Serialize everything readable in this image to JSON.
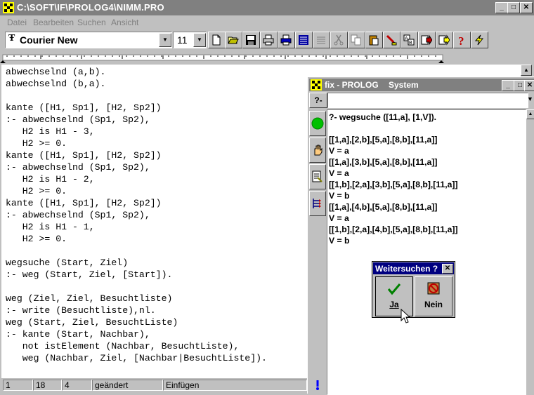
{
  "window": {
    "title": "C:\\SOFT\\IF\\PROLOG4\\NIMM.PRO",
    "minimize": "_",
    "maximize": "□",
    "close": "✕"
  },
  "menu": [
    "Datei",
    "Bearbeiten",
    "Suchen",
    "Ansicht"
  ],
  "toolbar": {
    "font_name": "Courier New",
    "font_size": "11",
    "icons": [
      "new-document-icon",
      "open-folder-icon",
      "save-icon",
      "print-icon",
      "print-preview-icon",
      "justify-icon",
      "align-icon",
      "cut-icon",
      "copy-icon",
      "paste-icon",
      "find-icon",
      "replace-icon",
      "run-icon",
      "consult-icon",
      "help-icon",
      "lightning-icon"
    ]
  },
  "editor": {
    "code": "abwechselnd (a,b).\nabwechselnd (b,a).\n\nkante ([H1, Sp1], [H2, Sp2])\n:- abwechselnd (Sp1, Sp2),\n   H2 is H1 - 3,\n   H2 >= 0.\nkante ([H1, Sp1], [H2, Sp2])\n:- abwechselnd (Sp1, Sp2),\n   H2 is H1 - 2,\n   H2 >= 0.\nkante ([H1, Sp1], [H2, Sp2])\n:- abwechselnd (Sp1, Sp2),\n   H2 is H1 - 1,\n   H2 >= 0.\n\nwegsuche (Start, Ziel)\n:- weg (Start, Ziel, [Start]).\n\nweg (Ziel, Ziel, Besuchtliste)\n:- write (Besuchtliste),nl.\nweg (Start, Ziel, BesuchtListe)\n:- kante (Start, Nachbar),\n   not istElement (Nachbar, BesuchtListe),\n   weg (Nachbar, Ziel, [Nachbar|BesuchtListe])."
  },
  "status": {
    "line": "1",
    "col": "18",
    "pos": "4",
    "state": "geändert",
    "mode": "Einfügen"
  },
  "prolog": {
    "title": "fix - PROLOG",
    "system_menu": "System",
    "query_label": "?-",
    "query_value": "",
    "sidebar_icons": [
      "go-icon",
      "stop-hand-icon",
      "consult-file-icon",
      "trace-icon"
    ],
    "output": "?- wegsuche ([11,a], [1,V]).\n\n[[1,a],[2,b],[5,a],[8,b],[11,a]]\nV = a\n[[1,a],[3,b],[5,a],[8,b],[11,a]]\nV = a\n[[1,b],[2,a],[3,b],[5,a],[8,b],[11,a]]\nV = b\n[[1,a],[4,b],[5,a],[8,b],[11,a]]\nV = a\n[[1,b],[2,a],[4,b],[5,a],[8,b],[11,a]]\nV = b"
  },
  "dialog": {
    "title": "Weitersuchen ?",
    "close": "✕",
    "yes_label": "Ja",
    "no_label": "Nein"
  }
}
